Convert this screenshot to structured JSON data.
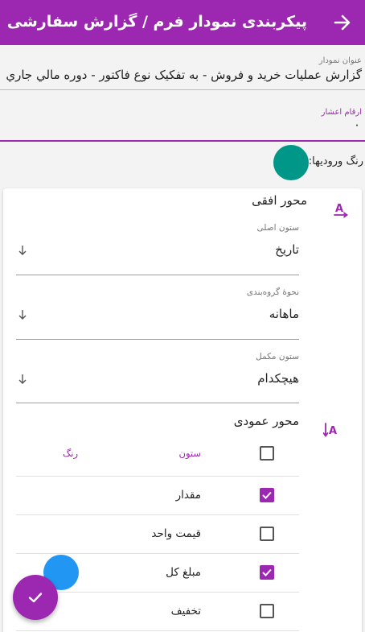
{
  "header": {
    "title": "پیکربندی نمودار فرم / گزارش سفارشی",
    "back_icon": "arrow-right-icon"
  },
  "form": {
    "chart_title_label": "عنوان نمودار",
    "chart_title_value": "گزارش عمليات خريد و فروش - به تفکيک نوع فاکتور - دوره مالي جاري",
    "decimals_label": "ارقام اعشار",
    "decimals_value": "۰",
    "input_color_label": "رنگ ورودیها:",
    "input_color": "#009688",
    "accent_color": "#9c27b0"
  },
  "horizontal_axis": {
    "title": "محور افقی",
    "icon": "horizontal-axis-icon",
    "main_column_label": "ستون اصلی",
    "main_column_value": "تاریخ",
    "grouping_label": "نحوهٔ گروه‌بندی",
    "grouping_value": "ماهانه",
    "complementary_label": "ستون مکمل",
    "complementary_value": "هیچکدام"
  },
  "vertical_axis": {
    "title": "محور عمودی",
    "icon": "vertical-axis-icon",
    "column_header": "ستون",
    "color_header": "رنگ",
    "rows": [
      {
        "label": "مقدار",
        "checked": true
      },
      {
        "label": "قیمت واحد",
        "checked": false
      },
      {
        "label": "مبلغ کل",
        "checked": true,
        "color": "#2196f3"
      },
      {
        "label": "تخفیف",
        "checked": false
      }
    ]
  },
  "fab": {
    "icon": "check-icon"
  }
}
